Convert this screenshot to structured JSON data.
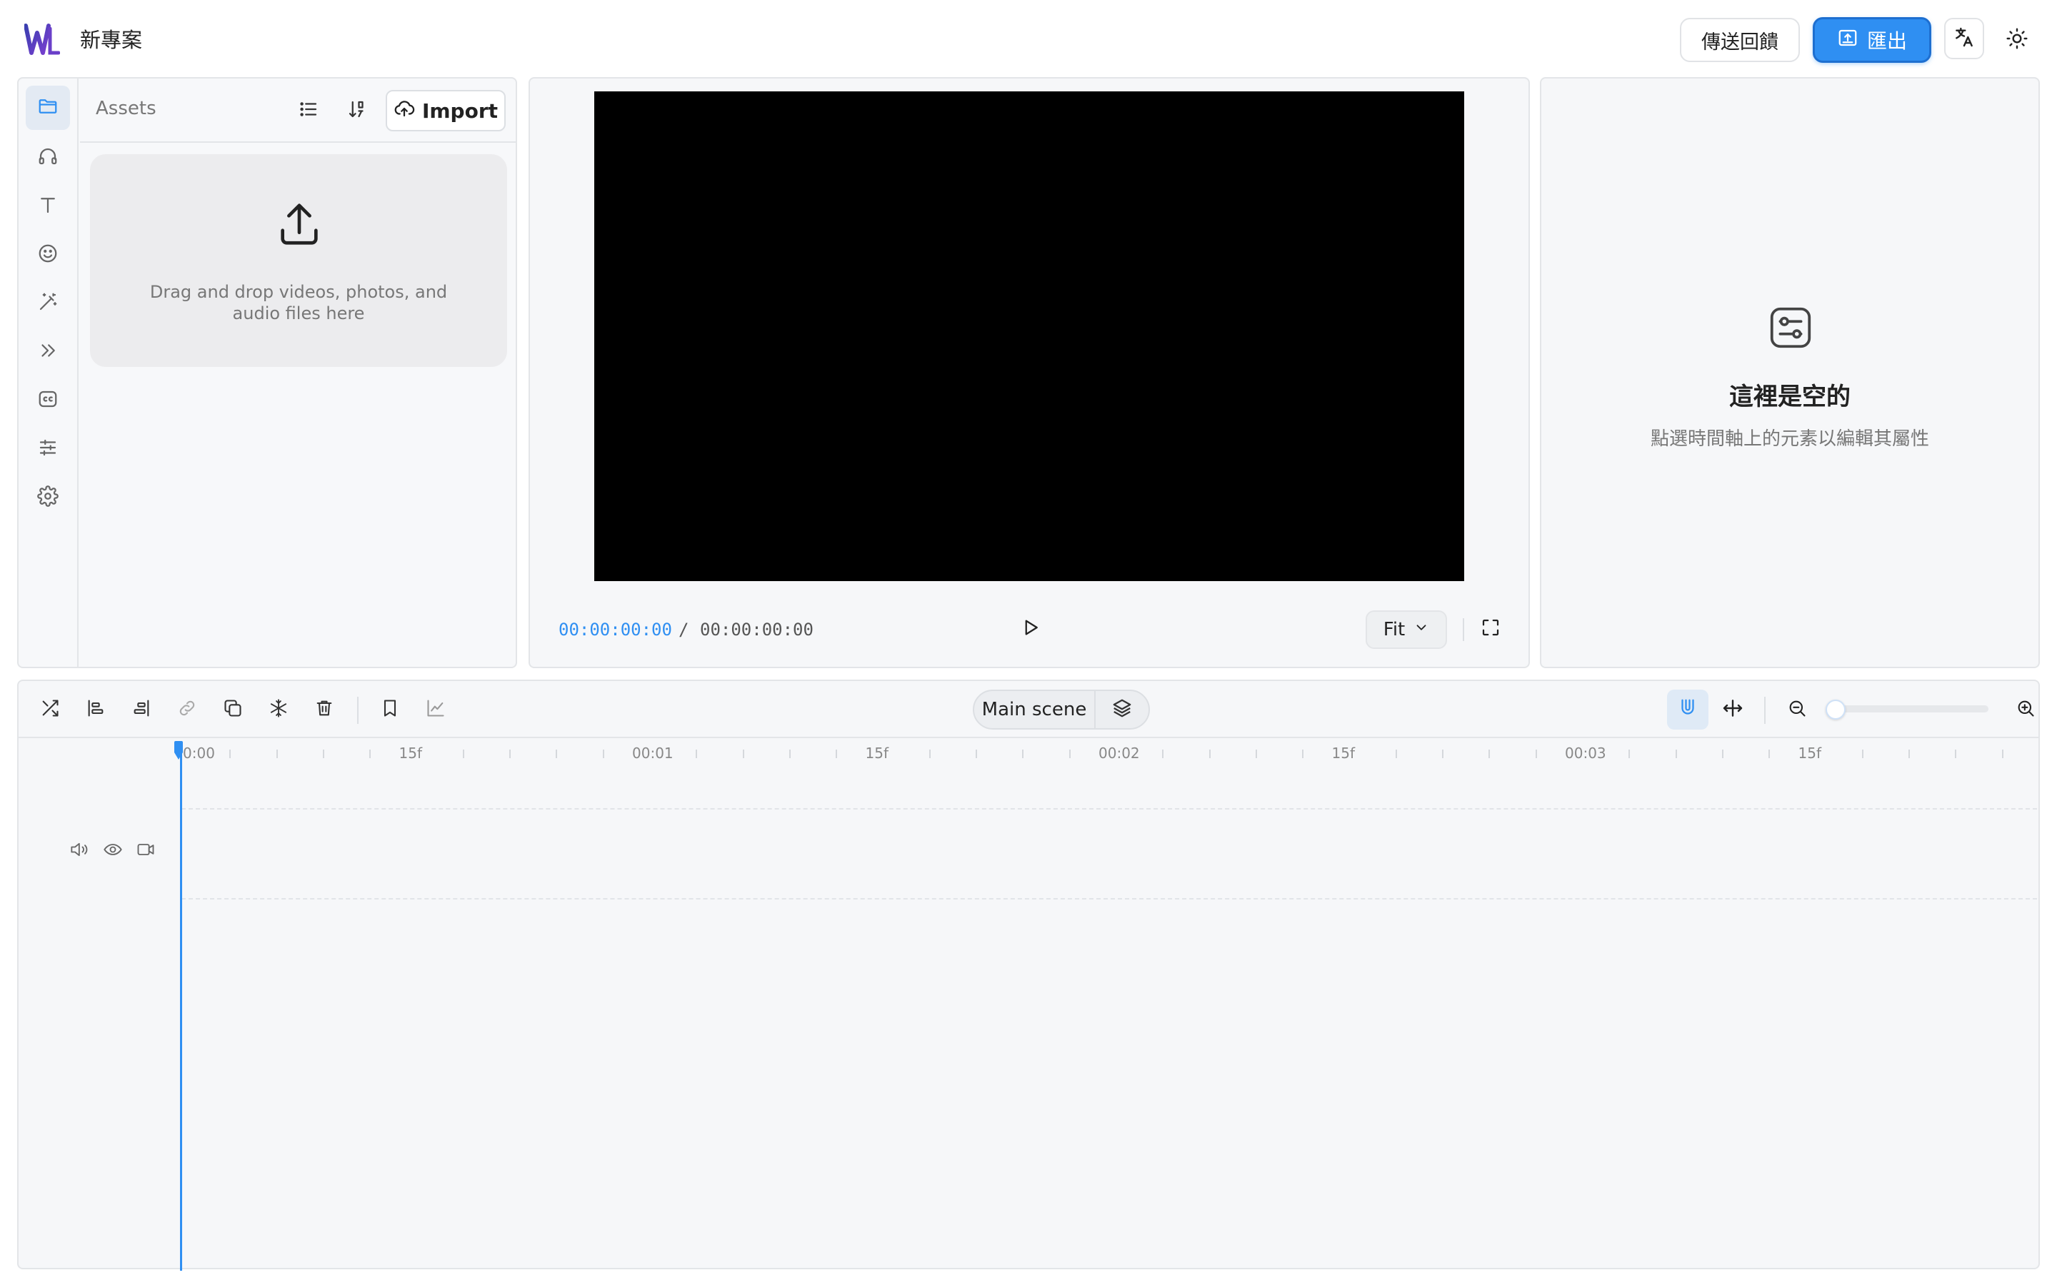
{
  "app": {
    "project_title": "新專案",
    "feedback_label": "傳送回饋",
    "export_label": "匯出"
  },
  "assets": {
    "title": "Assets",
    "import_label": "Import",
    "dropzone_text": "Drag and drop videos, photos, and audio files here"
  },
  "sidebar": {
    "items": [
      {
        "icon": "folder-icon",
        "active": true
      },
      {
        "icon": "headphones-icon",
        "active": false
      },
      {
        "icon": "text-icon",
        "active": false
      },
      {
        "icon": "smiley-icon",
        "active": false
      },
      {
        "icon": "magic-wand-icon",
        "active": false
      },
      {
        "icon": "chevrons-right-icon",
        "active": false
      },
      {
        "icon": "captions-icon",
        "active": false
      },
      {
        "icon": "sliders-icon",
        "active": false
      },
      {
        "icon": "settings-icon",
        "active": false
      }
    ]
  },
  "player": {
    "current_time": "00:00:00:00",
    "separator": "/",
    "total_time": "00:00:00:00",
    "fit_label": "Fit"
  },
  "properties": {
    "empty_title": "這裡是空的",
    "empty_subtitle": "點選時間軸上的元素以編輯其屬性"
  },
  "timeline": {
    "scene_label": "Main scene",
    "ruler_labels": [
      "0:00",
      "15f",
      "00:01",
      "15f",
      "00:02",
      "15f",
      "00:03",
      "15f"
    ],
    "zoom_level": 0
  },
  "colors": {
    "accent": "#2f8ff2",
    "panel_bg": "#f6f7f9",
    "border": "#e3e5e8"
  }
}
